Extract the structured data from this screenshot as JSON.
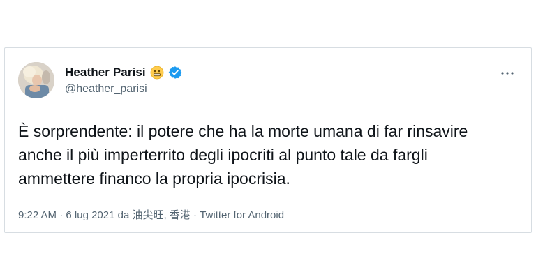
{
  "tweet": {
    "author": {
      "display_name": "Heather Parisi",
      "handle": "@heather_parisi",
      "name_emoji": "grimacing-face-emoji",
      "verified_icon": "verified-badge-icon",
      "verified_color": "#1d9bf0"
    },
    "menu_icon": "more-options-icon",
    "text": "È sorprendente: il potere che ha la morte umana di far rinsavire anche il più imperterrito degli ipocriti al punto tale da fargli ammettere financo la propria ipocrisia.",
    "meta": {
      "time": "9:22 AM",
      "separator": " · ",
      "date": "6 lug 2021",
      "location_prefix": " da ",
      "location": "油尖旺, 香港",
      "source": "Twitter for Android"
    }
  }
}
